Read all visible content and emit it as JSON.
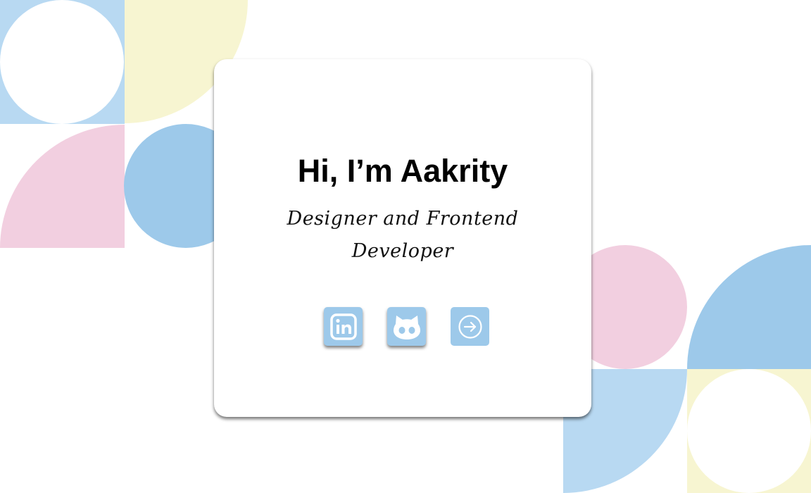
{
  "hero": {
    "headline": "Hi, I’m Aakrity",
    "subtitle": "Designer and Frontend Developer"
  },
  "social": [
    {
      "name": "linkedin",
      "icon": "linkedin-icon"
    },
    {
      "name": "github",
      "icon": "github-cat-icon"
    },
    {
      "name": "next",
      "icon": "arrow-right-circle-icon"
    }
  ],
  "colors": {
    "blue": "#9dc9ea",
    "light_blue": "#b8d9f2",
    "pink": "#f2cfe0",
    "cream": "#f7f5d1",
    "card": "#ffffff",
    "text": "#000000"
  }
}
